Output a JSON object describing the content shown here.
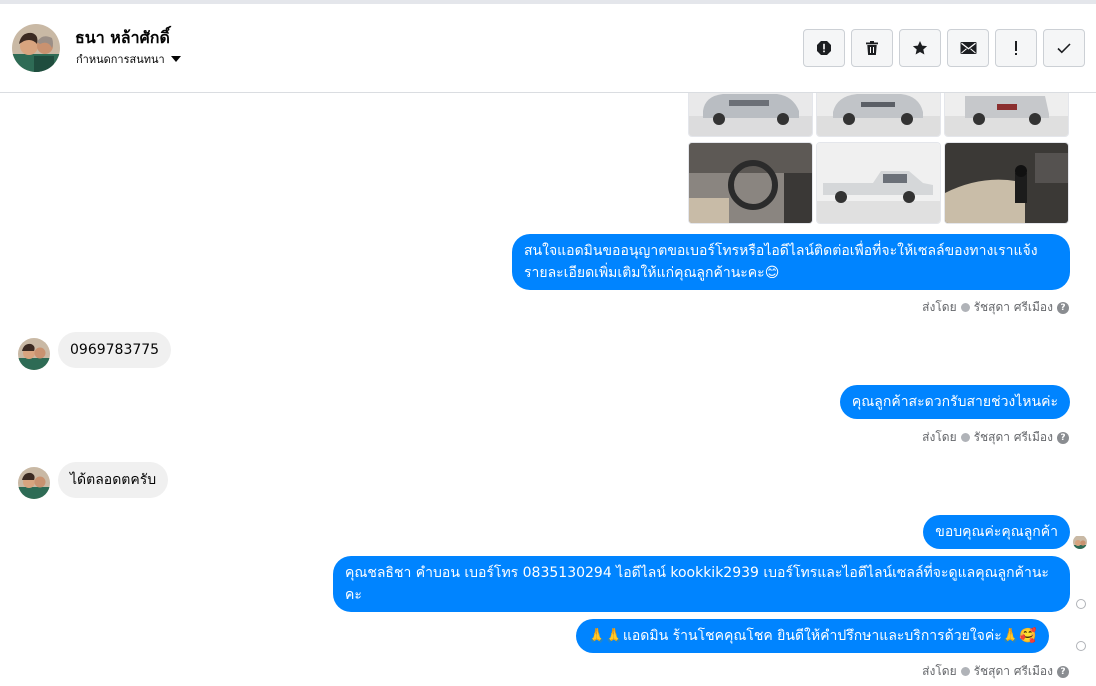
{
  "header": {
    "contact_name": "ธนา หล้าศักดิ์",
    "customize_label": "กำหนดการสนทนา",
    "actions": [
      "report-icon",
      "trash-icon",
      "star-icon",
      "mail-icon",
      "exclamation-icon",
      "check-icon"
    ]
  },
  "messages": {
    "out1": "สนใจแอดมินขออนุญาตขอเบอร์โทรหรือไอดีไลน์ติดต่อเพื่อที่จะให้เซลล์ของทางเราแจ้งรายละเอียดเพิ่มเติมให้แก่คุณลูกค้านะคะ😊",
    "in1": "0969783775",
    "out2": "คุณลูกค้าสะดวกรับสายช่วงไหนค่ะ",
    "in2": "ได้ตลอดตครับ",
    "out3": "ขอบคุณค่ะคุณลูกค้า",
    "out4": "คุณชลธิชา คำบอน  เบอร์โทร 0835130294  ไอดีไลน์ kookkik2939   เบอร์โทรและไอดีไลน์เซลล์ที่จะดูแลคุณลูกค้านะคะ",
    "out5": "🙏🙏แอดมิน ร้านโชคคุณโชค ยินดีให้คำปรึกษาและบริการด้วยใจค่ะ🙏🥰"
  },
  "sent_by": {
    "prefix": "ส่งโดย",
    "name": "รัชสุดา ศรีเมือง",
    "help": "?"
  },
  "colors": {
    "outgoing_bubble": "#0084ff",
    "incoming_bubble": "#f0f0f0",
    "meta_text": "#65676b"
  }
}
